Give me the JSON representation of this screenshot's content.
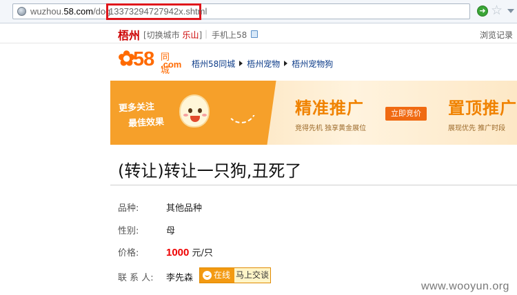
{
  "browser": {
    "url_prefix": "wuzhou.",
    "url_domain": "58.com",
    "url_path": "/dog",
    "url_highlighted": "13373294727942x.shtml"
  },
  "topbar": {
    "city": "梧州",
    "switch_city_prefix": "[切换城市 ",
    "current_city": "乐山",
    "switch_city_suffix": "]",
    "separator": "|",
    "mobile": "手机上58",
    "history": "浏览记录"
  },
  "logo": {
    "number": "58",
    "cn": "同城",
    "com": ".com"
  },
  "breadcrumb": [
    "梧州58同城",
    "梧州宠物",
    "梧州宠物狗"
  ],
  "banner": {
    "slogan_line1": "更多关注",
    "slogan_line2": "最佳效果",
    "promo1": "精准推广",
    "promo1_sub": "竞得先机 独享黄金展位",
    "button": "立即竞价",
    "promo2": "置顶推广",
    "promo2_sub": "展现优先 推广时段"
  },
  "post": {
    "title": "(转让)转让一只狗,丑死了",
    "breed_label": "品种:",
    "breed": "其他品种",
    "gender_label": "性别:",
    "gender": "母",
    "price_label": "价格:",
    "price": "1000",
    "price_unit": "元/只",
    "contact_label": "联 系 人:",
    "contact": "李先森",
    "chat_online": "在线",
    "chat_action": "马上交谈"
  },
  "watermark": "www.wooyun.org",
  "colors": {
    "brand_orange": "#ff6a00",
    "city_red": "#cc0000",
    "price_red": "#ee0000",
    "highlight_box": "#e0151b",
    "link_blue": "#0d3c89"
  }
}
